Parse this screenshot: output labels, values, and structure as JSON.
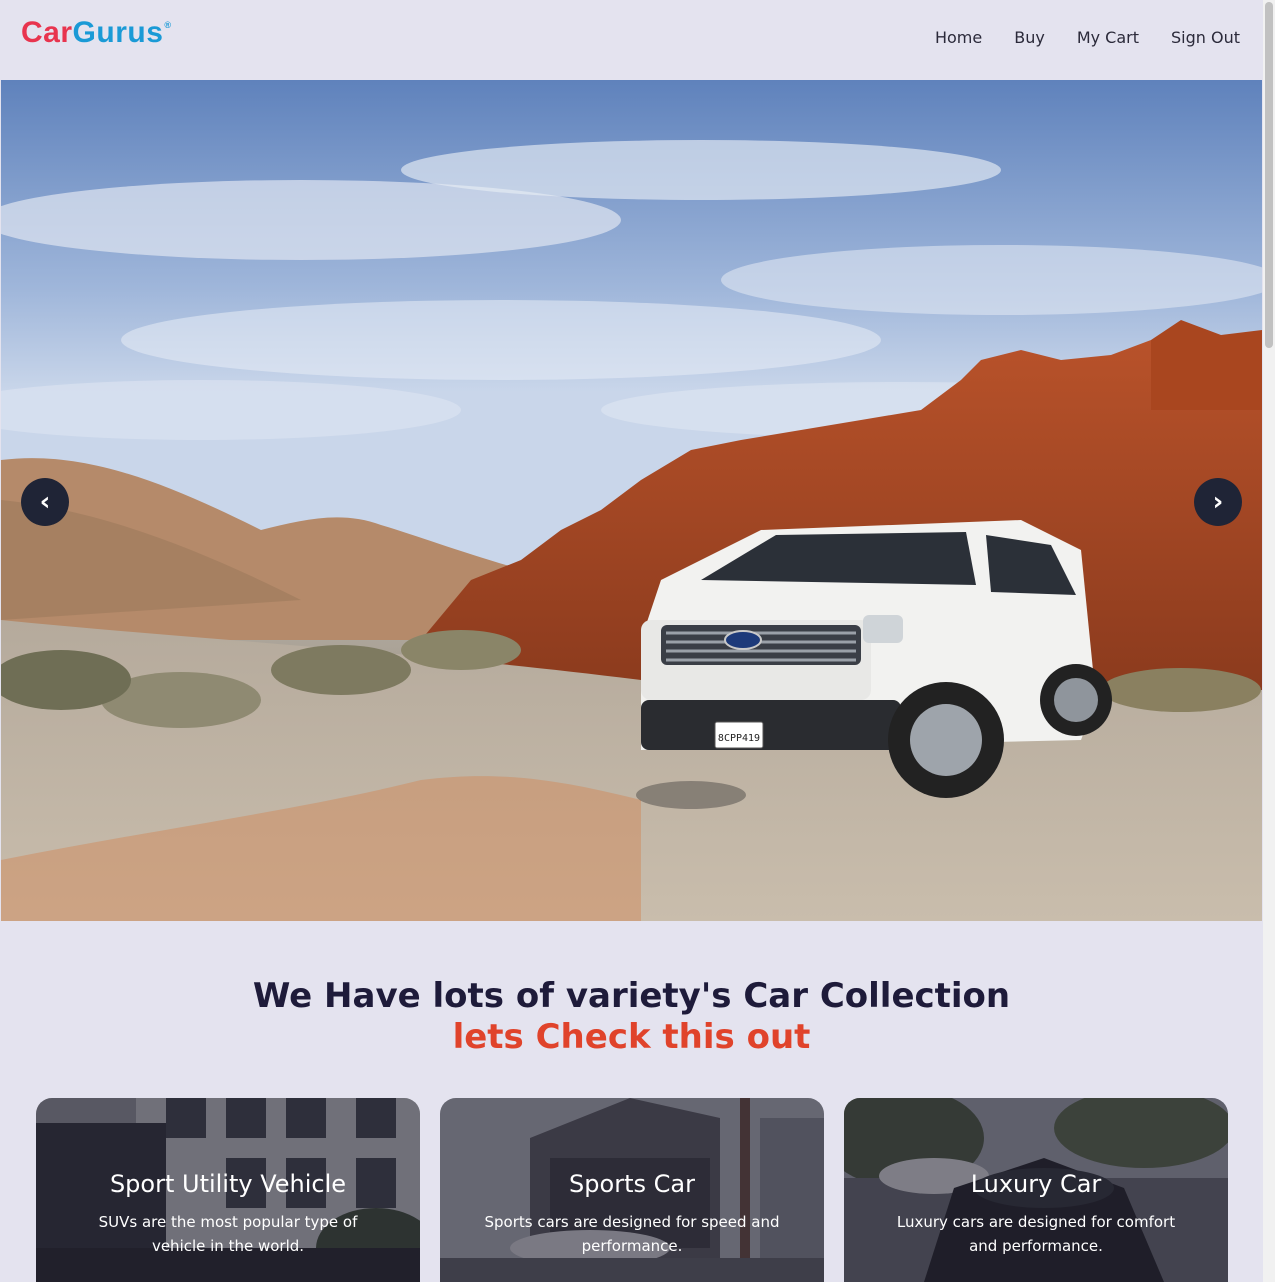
{
  "header": {
    "logo": {
      "part1": "Car",
      "part2": "Gurus",
      "reg": "®"
    },
    "nav": [
      "Home",
      "Buy",
      "My Cart",
      "Sign Out"
    ]
  },
  "hero": {
    "prev_label": "‹",
    "next_label": "›",
    "plate": "8CPP419"
  },
  "collection": {
    "title": "We Have lots of variety's Car Collection",
    "subtitle": "lets Check this out",
    "cards": [
      {
        "title": "Sport Utility Vehicle",
        "desc": "SUVs are the most popular type of vehicle in the world."
      },
      {
        "title": "Sports Car",
        "desc": "Sports cars are designed for speed and performance."
      },
      {
        "title": "Luxury Car",
        "desc": "Luxury cars are designed for comfort and performance."
      }
    ]
  },
  "colors": {
    "background": "#e4e3ef",
    "logo_red": "#e8344e",
    "logo_blue": "#1a9ad6",
    "accent": "#e0432b",
    "heading": "#1e1b3a"
  }
}
